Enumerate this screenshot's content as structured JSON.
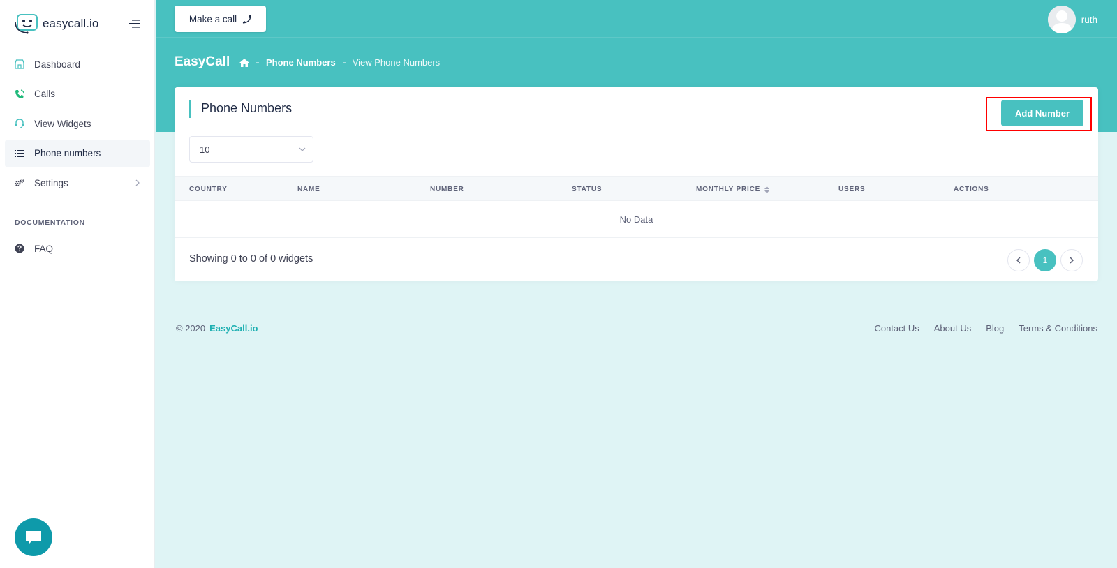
{
  "sidebar": {
    "brand": "easycall.io",
    "items": [
      {
        "label": "Dashboard"
      },
      {
        "label": "Calls"
      },
      {
        "label": "View Widgets"
      },
      {
        "label": "Phone numbers"
      },
      {
        "label": "Settings"
      }
    ],
    "section_label": "DOCUMENTATION",
    "faq_label": "FAQ"
  },
  "header": {
    "make_call_label": "Make a call",
    "user_name": "ruth",
    "page_heading": "EasyCall",
    "breadcrumb": [
      "Phone Numbers",
      "View Phone Numbers"
    ]
  },
  "card": {
    "title": "Phone Numbers",
    "add_button_label": "Add Number",
    "page_size": "10",
    "columns": [
      "COUNTRY",
      "NAME",
      "NUMBER",
      "STATUS",
      "MONTHLY PRICE",
      "USERS",
      "ACTIONS"
    ],
    "empty_text": "No Data",
    "showing_text": "Showing 0 to 0 of 0 widgets",
    "current_page": "1"
  },
  "footer": {
    "copyright": "© 2020",
    "brand_link": "EasyCall.io",
    "links": [
      "Contact Us",
      "About Us",
      "Blog",
      "Terms & Conditions"
    ]
  },
  "colors": {
    "accent": "#48c1c0",
    "background": "#dff4f5",
    "annotation": "#ff0000"
  },
  "annotations": {
    "highlight": "red-box-around-add-number",
    "arrow": "red-arrow-pointing-to-add-number"
  }
}
